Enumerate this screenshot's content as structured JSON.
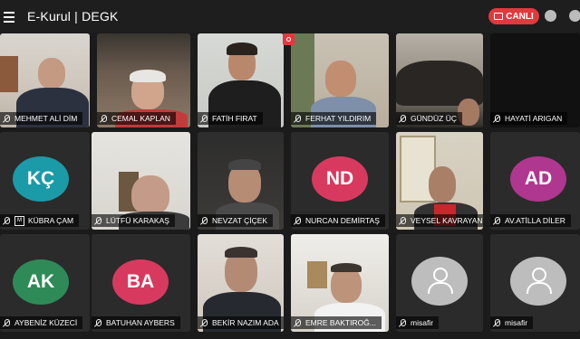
{
  "header": {
    "title": "E-Kurul | DEGK",
    "live_label": "CANLI",
    "live_color": "#e0393e",
    "menu_icon": "hamburger-menu-icon",
    "notification_icon": "bell-icon",
    "profile_icon": "account-icon"
  },
  "participants": [
    {
      "name": "MEHMET ALİ DİM",
      "type": "video"
    },
    {
      "name": "CEMAL KAPLAN",
      "type": "video"
    },
    {
      "name": "FATİH FIRAT",
      "type": "video"
    },
    {
      "name": "FERHAT YILDIRIM",
      "type": "video"
    },
    {
      "name": "GÜNDÜZ ÜÇ",
      "type": "video"
    },
    {
      "name": "HAYATİ ARIGAN",
      "type": "blank"
    },
    {
      "name": "KÜBRA ÇAM",
      "type": "avatar",
      "initials": "KÇ",
      "color": "#1b9aa8",
      "moderator": true
    },
    {
      "name": "LÜTFÜ KARAKAŞ",
      "type": "video"
    },
    {
      "name": "NEVZAT ÇİÇEK",
      "type": "video"
    },
    {
      "name": "NURCAN DEMİRTAŞ",
      "type": "avatar",
      "initials": "ND",
      "color": "#d83a5f"
    },
    {
      "name": "VEYSEL KAVRAYAN",
      "type": "video"
    },
    {
      "name": "AV.ATİLLA DİLER",
      "type": "avatar",
      "initials": "AD",
      "color": "#b0378f"
    },
    {
      "name": "AYBENİZ KÜZECİ",
      "type": "avatar",
      "initials": "AK",
      "color": "#2e8b57"
    },
    {
      "name": "BATUHAN AYBERS",
      "type": "avatar",
      "initials": "BA",
      "color": "#d83a5f"
    },
    {
      "name": "BEKİR NAZIM ADA",
      "type": "video"
    },
    {
      "name": "EMRE BAKTIROĞ...",
      "type": "video"
    },
    {
      "name": "misafir",
      "type": "guest"
    },
    {
      "name": "misafir",
      "type": "guest"
    }
  ]
}
